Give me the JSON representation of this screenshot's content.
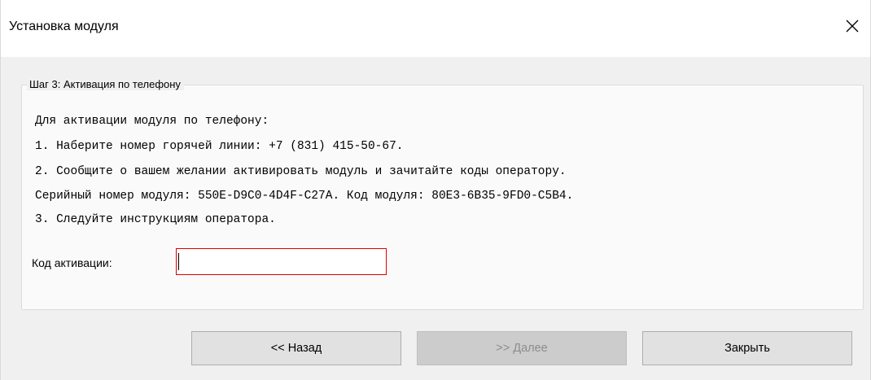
{
  "window": {
    "title": "Установка модуля"
  },
  "step": {
    "legend": "Шаг 3: Активация по телефону",
    "instructions": [
      "Для активации модуля по телефону:",
      "1. Наберите номер горячей линии: +7 (831) 415-50-67.",
      "2. Сообщите о вашем желании активировать модуль и зачитайте коды оператору.",
      "Серийный номер модуля: 550E-D9C0-4D4F-C27A. Код модуля: 80E3-6B35-9FD0-C5B4.",
      "3. Следуйте инструкциям оператора."
    ],
    "code_label": "Код активации:",
    "code_value": ""
  },
  "buttons": {
    "back": "<< Назад",
    "next": ">> Далее",
    "close": "Закрыть"
  },
  "icons": {
    "close": "close-icon"
  }
}
